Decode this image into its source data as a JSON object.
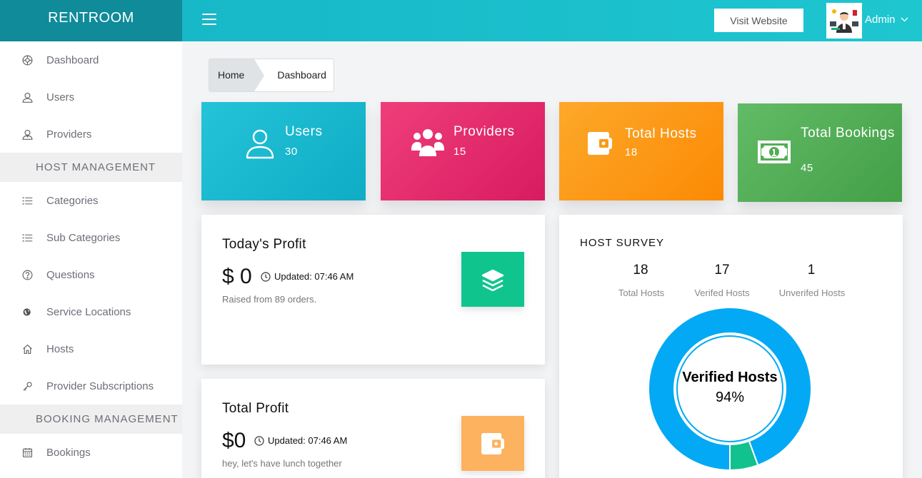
{
  "brand": "RENTROOM",
  "sidebar": {
    "items": [
      {
        "label": "Dashboard",
        "icon": "dashboard-icon"
      },
      {
        "label": "Users",
        "icon": "user-icon"
      },
      {
        "label": "Providers",
        "icon": "provider-icon"
      }
    ],
    "section_host": "HOST MANAGEMENT",
    "host_items": [
      {
        "label": "Categories",
        "icon": "list-icon"
      },
      {
        "label": "Sub Categories",
        "icon": "list-icon"
      },
      {
        "label": "Questions",
        "icon": "question-icon"
      },
      {
        "label": "Service Locations",
        "icon": "globe-icon"
      },
      {
        "label": "Hosts",
        "icon": "home-icon"
      },
      {
        "label": "Provider Subscriptions",
        "icon": "key-icon"
      }
    ],
    "section_booking": "BOOKING MANAGEMENT",
    "booking_items": [
      {
        "label": "Bookings",
        "icon": "calendar-icon"
      }
    ]
  },
  "topbar": {
    "visit_label": "Visit Website",
    "user_name": "Admin"
  },
  "breadcrumb": {
    "home": "Home",
    "current": "Dashboard"
  },
  "stats": {
    "users": {
      "title": "Users",
      "value": "30",
      "color": "#17b3cc"
    },
    "providers": {
      "title": "Providers",
      "value": "15",
      "color": "#e12d6d"
    },
    "hosts": {
      "title": "Total Hosts",
      "value": "18",
      "color": "#fc9a16"
    },
    "bookings": {
      "title": "Total Bookings",
      "value": "45",
      "color": "#52ad56"
    }
  },
  "today_profit": {
    "title": "Today's Profit",
    "amount": "$ 0",
    "updated": "Updated: 07:46 AM",
    "note": "Raised from 89 orders.",
    "color": "#10c48e"
  },
  "total_profit": {
    "title": "Total Profit",
    "amount": "$0",
    "updated": "Updated: 07:46 AM",
    "note": "hey, let's have lunch together",
    "color": "#fdb25f"
  },
  "survey": {
    "title": "HOST SURVEY",
    "stats": [
      {
        "value": "18",
        "label": "Total Hosts"
      },
      {
        "value": "17",
        "label": "Verifed Hosts"
      },
      {
        "value": "1",
        "label": "Unverifed Hosts"
      }
    ],
    "donut_label": "Verified Hosts",
    "donut_value": "94%",
    "verified_fraction": 0.944,
    "verified_color": "#03a9f4",
    "unverified_color": "#11c18e"
  }
}
